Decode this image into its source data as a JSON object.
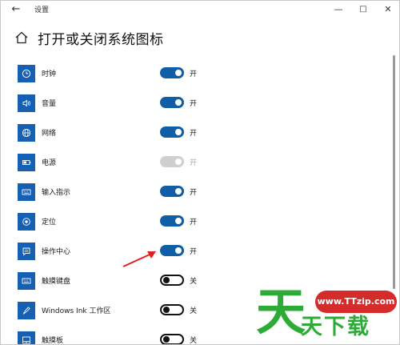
{
  "window": {
    "title": "设置",
    "back_icon": "back-arrow-icon",
    "minimize_icon": "minimize-icon",
    "maximize_icon": "maximize-icon",
    "close_icon": "close-icon"
  },
  "header": {
    "home_icon": "home-icon",
    "title": "打开或关闭系统图标"
  },
  "colors": {
    "accent": "#0f5ea6",
    "icon_tile": "#1560b2",
    "toggle_off_border": "#111111",
    "toggle_disabled": "#cfcfcf",
    "annotation_arrow": "#e02020"
  },
  "items": [
    {
      "label": "时钟",
      "icon": "clock-icon",
      "state": "开",
      "toggle": "on"
    },
    {
      "label": "音量",
      "icon": "speaker-icon",
      "state": "开",
      "toggle": "on"
    },
    {
      "label": "网络",
      "icon": "globe-icon",
      "state": "开",
      "toggle": "on"
    },
    {
      "label": "电源",
      "icon": "battery-icon",
      "state": "开",
      "toggle": "disabled"
    },
    {
      "label": "输入指示",
      "icon": "keyboard-icon",
      "state": "开",
      "toggle": "on"
    },
    {
      "label": "定位",
      "icon": "location-icon",
      "state": "开",
      "toggle": "on"
    },
    {
      "label": "操作中心",
      "icon": "action-center-icon",
      "state": "开",
      "toggle": "on"
    },
    {
      "label": "触摸键盘",
      "icon": "keyboard-icon",
      "state": "关",
      "toggle": "off"
    },
    {
      "label": "Windows Ink 工作区",
      "icon": "pen-icon",
      "state": "关",
      "toggle": "off"
    },
    {
      "label": "触摸板",
      "icon": "touchpad-icon",
      "state": "关",
      "toggle": "off"
    }
  ],
  "watermark": {
    "url": "www.TTzip.com",
    "big_char": "天",
    "small_text": "天下载"
  }
}
